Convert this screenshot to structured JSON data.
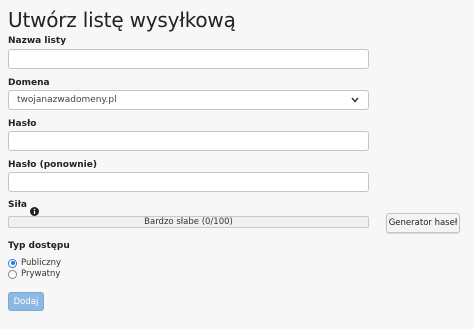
{
  "page": {
    "title": "Utwórz listę wysyłkową"
  },
  "form": {
    "list_name": {
      "label": "Nazwa listy",
      "value": ""
    },
    "domain": {
      "label": "Domena",
      "selected": "twojanazwadomeny.pl"
    },
    "password": {
      "label": "Hasło",
      "value": ""
    },
    "password_repeat": {
      "label": "Hasło (ponownie)",
      "value": ""
    },
    "strength": {
      "label": "Siła",
      "text": "Bardzo słabe (0/100)",
      "score": 0,
      "max": 100,
      "info_icon": "info-circle-icon"
    },
    "generator_label": "Generator haseł",
    "access_type": {
      "label": "Typ dostępu",
      "options": [
        {
          "label": "Publiczny",
          "checked": true
        },
        {
          "label": "Prywatny",
          "checked": false
        }
      ]
    },
    "submit_label": "Dodaj"
  },
  "colors": {
    "background": "#f7f7f7",
    "accent": "#2a7ae2",
    "submit_disabled": "#8db8e3"
  }
}
